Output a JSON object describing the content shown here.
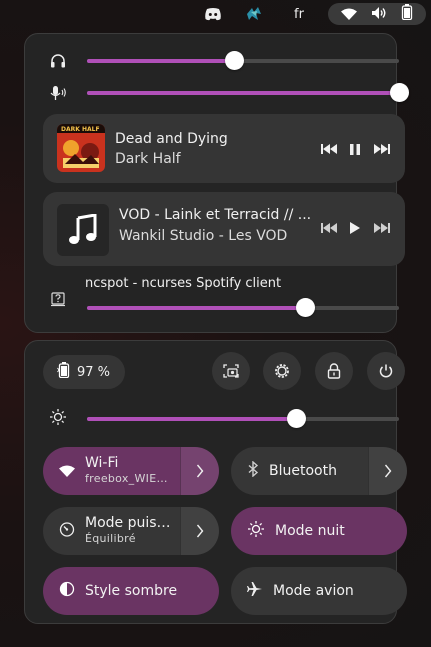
{
  "topbar": {
    "keyboard_layout": "fr",
    "icons": [
      "discord-icon",
      "app-tray-icon",
      "wifi-icon",
      "volume-icon",
      "battery-icon"
    ]
  },
  "audio": {
    "output_volume": 0.47,
    "input_volume": 1.0
  },
  "media": [
    {
      "title": "Dead and Dying",
      "artist": "Dark Half",
      "cover_text": "DARK HALF",
      "playing": true
    },
    {
      "title": "VOD - Laink et Terracid // ...",
      "artist": "Wankil Studio - Les VOD",
      "playing": false
    }
  ],
  "app_volume": {
    "app_name": "ncspot - ncurses Spotify client",
    "level": 0.7
  },
  "battery": {
    "label": "97 %"
  },
  "brightness": {
    "level": 0.67
  },
  "tiles": {
    "wifi": {
      "title": "Wi-Fi",
      "subtitle": "freebox_WIE…",
      "active": true
    },
    "bluetooth": {
      "title": "Bluetooth",
      "active": false
    },
    "power_mode": {
      "title": "Mode puis…",
      "subtitle": "Équilibré",
      "active": false
    },
    "night_mode": {
      "title": "Mode nuit",
      "active": true
    },
    "dark_style": {
      "title": "Style sombre",
      "active": true
    },
    "airplane": {
      "title": "Mode avion",
      "active": false
    }
  },
  "colors": {
    "accent": "#b050b8",
    "tile_active": "#6a3463",
    "tile_inactive": "#363636",
    "panel": "#242424"
  }
}
